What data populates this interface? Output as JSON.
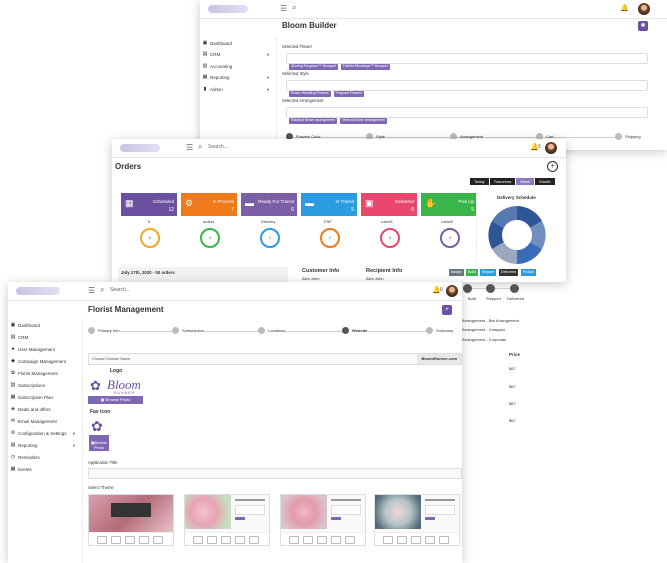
{
  "back_window": {
    "title": "Bloom Builder",
    "sidebar": [
      "Dashboard",
      "CRM",
      "Accounting",
      "Reporting",
      "Admin"
    ],
    "fields": [
      {
        "label": "Selected Flower",
        "chips": [
          "Alluring Elegance™ Bouquet",
          "Faithful Blessings™ Bouquet"
        ]
      },
      {
        "label": "Selected Style",
        "chips": [
          "Rustic Wedding Flowers",
          "Fragrant Flowers"
        ]
      },
      {
        "label": "Selected Arrangement",
        "chips": [
          "Elliptical flower arrangement",
          "Vertical flower arrangement"
        ]
      }
    ],
    "steps": [
      "Flowers Color",
      "Style",
      "Arrangement",
      "Cart",
      "Shipping"
    ]
  },
  "mid_window": {
    "search_placeholder": "Search...",
    "title": "Orders",
    "bell_count": "8",
    "ranges": [
      "Today",
      "Tomorrow",
      "Week",
      "Month"
    ],
    "active_range": "Week",
    "cards": [
      {
        "label": "Scheduled",
        "count": "12",
        "color": "#6b4fa0"
      },
      {
        "label": "In Process",
        "count": "7",
        "color": "#f07a1a"
      },
      {
        "label": "Ready For Transit",
        "count": "6",
        "color": "#7a5fa6"
      },
      {
        "label": "In Transit",
        "count": "5",
        "color": "#2b9ce0"
      },
      {
        "label": "Delivered",
        "count": "8",
        "color": "#e9466e"
      },
      {
        "label": "Pick Up",
        "count": "5",
        "color": "#3ab54a"
      }
    ],
    "rings": [
      {
        "label": "5",
        "value": "6",
        "color": "#f5a623"
      },
      {
        "label": "orders",
        "value": "4",
        "color": "#3ab54a"
      },
      {
        "label": "Delivery",
        "value": "2",
        "color": "#2b9ce0"
      },
      {
        "label": "FNF",
        "value": "2",
        "color": "#f07a1a"
      },
      {
        "label": "Label1",
        "value": "4",
        "color": "#e9466e"
      },
      {
        "label": "Label2",
        "value": "4",
        "color": "#7a5fa6"
      }
    ],
    "orders_header": "July 17th, 2020 - 50 orders",
    "customer_info": "Customer Info",
    "customer_name": "Alex John",
    "recipient_info": "Recipient Info",
    "recipient_name": "Alex John",
    "action_buttons": [
      {
        "label": "Assign",
        "color": "#6c757d"
      },
      {
        "label": "Build",
        "color": "#3ab54a"
      },
      {
        "label": "Shipper",
        "color": "#2b9ce0"
      },
      {
        "label": "Delivered",
        "color": "#333333"
      },
      {
        "label": "Picked",
        "color": "#2b9ce0"
      }
    ],
    "schedule_title": "Delivery Schedule",
    "status_steps": [
      "Built",
      "Shipped",
      "Delivered"
    ],
    "arrangements": [
      "Bar Arrangement",
      "Compact",
      "Corporate"
    ],
    "arr_prefix": "Arrangement - ",
    "price_header": "Price",
    "prices": [
      "$67",
      "$67",
      "$67",
      "$67"
    ]
  },
  "front_window": {
    "search_placeholder": "Search...",
    "bell_count": "8",
    "title": "Florist Management",
    "sidebar": [
      "Dashboard",
      "CRM",
      "User Management",
      "Campaign Management",
      "Florist Management",
      "Subscriptions",
      "Subscription Plan",
      "Deals and offers",
      "Email Management",
      "Configuration & Settings",
      "Reporting",
      "Reminders",
      "Events"
    ],
    "steps": [
      "Primary Info",
      "Subscription",
      "Locations",
      "Website",
      "Summary"
    ],
    "active_step": "Website",
    "domain_placeholder": "Choose Domain Name",
    "domain_suffix": "BloomRunner.com",
    "logo_label": "Logo",
    "logo_text": "Bloom",
    "logo_sub": "RUNNER",
    "browse_photo": "Browse Photo",
    "fav_label": "Fav icon",
    "browse_photo_2": "Browse\nPhoto",
    "app_title_label": "Application Title",
    "theme_label": "Select Theme"
  }
}
